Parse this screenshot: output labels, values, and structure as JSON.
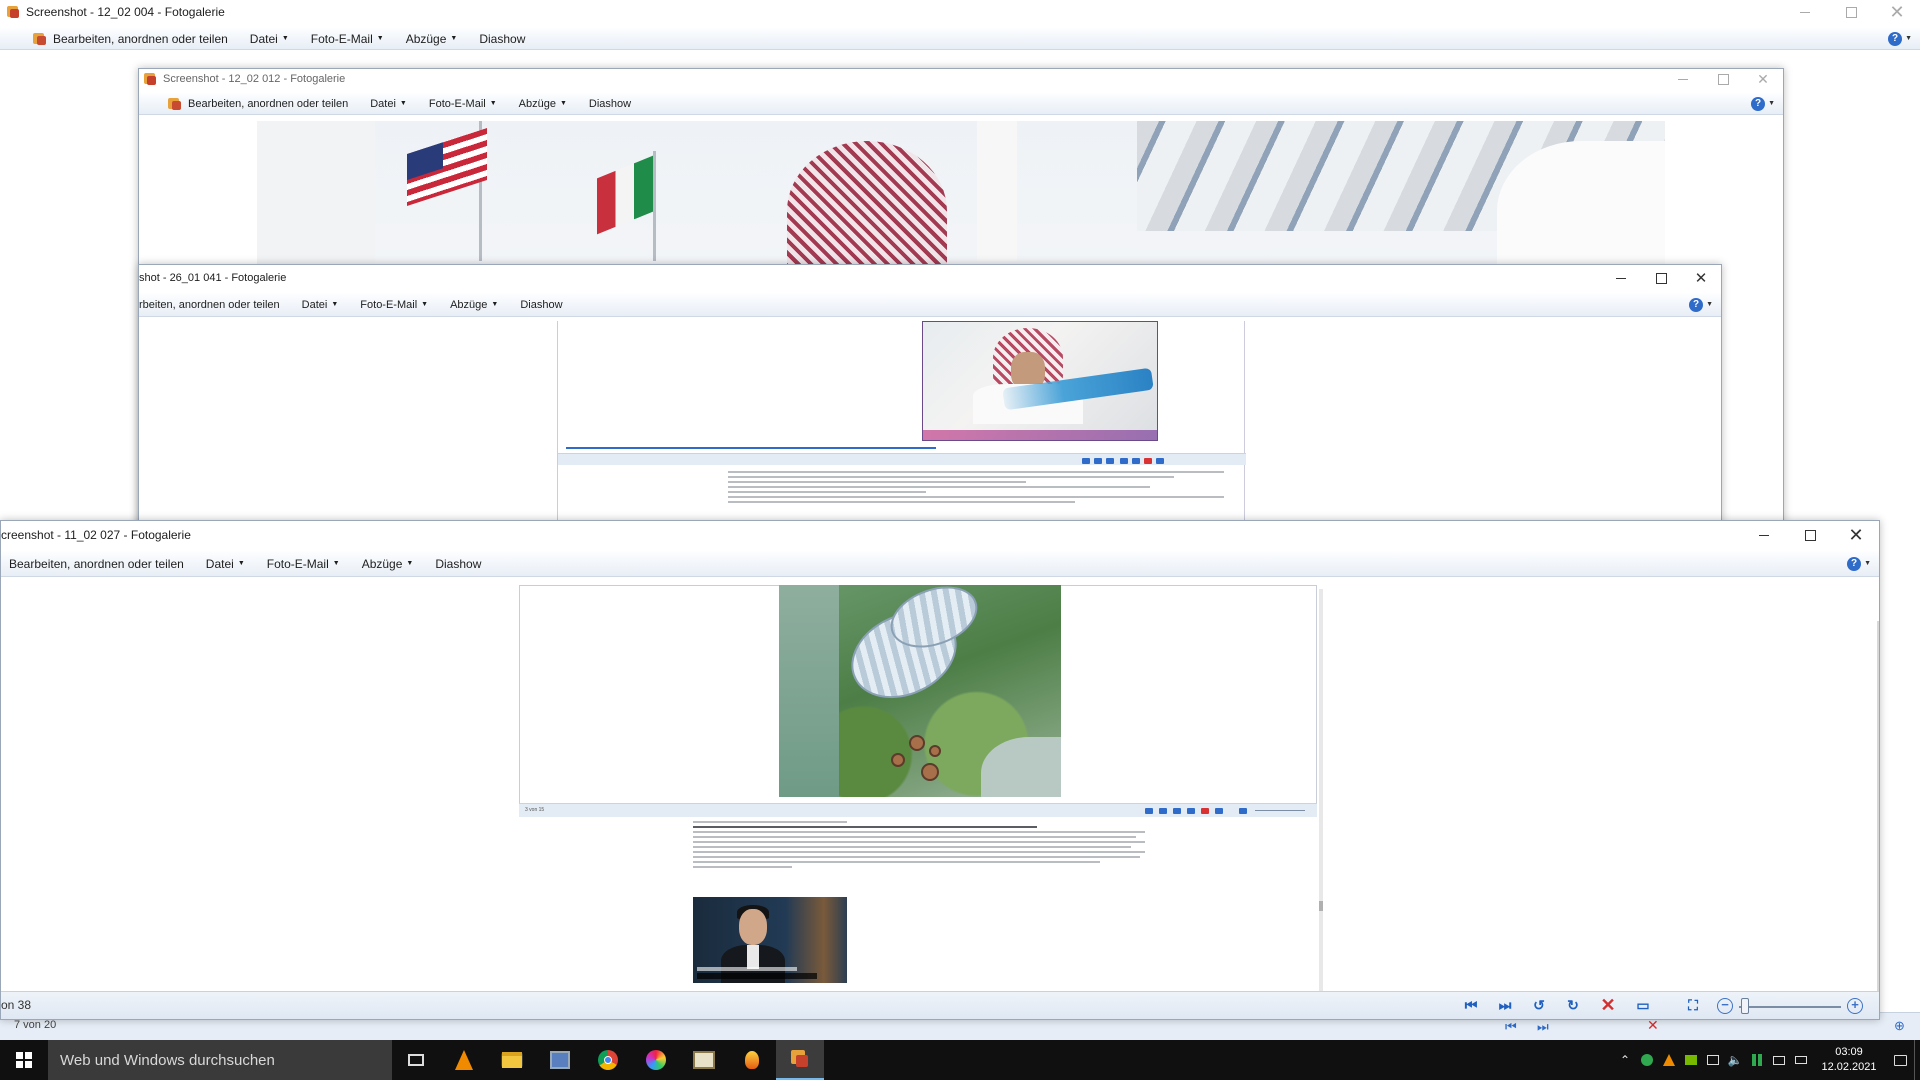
{
  "back_window": {
    "title": "Screenshot - 12_02 004 - Fotogalerie",
    "menu": {
      "edit": "Bearbeiten, anordnen oder teilen",
      "file": "Datei",
      "email": "Foto-E-Mail",
      "prints": "Abzüge",
      "slideshow": "Diashow"
    },
    "footer_counter": "7 von 20"
  },
  "window2": {
    "title": "Screenshot - 12_02 012 - Fotogalerie",
    "menu": {
      "edit": "Bearbeiten, anordnen oder teilen",
      "file": "Datei",
      "email": "Foto-E-Mail",
      "prints": "Abzüge",
      "slideshow": "Diashow"
    }
  },
  "window3": {
    "title": "shot - 26_01 041 - Fotogalerie",
    "menu": {
      "edit": "rbeiten, anordnen oder teilen",
      "file": "Datei",
      "email": "Foto-E-Mail",
      "prints": "Abzüge",
      "slideshow": "Diashow"
    }
  },
  "front_window": {
    "title": "creenshot - 11_02 027 - Fotogalerie",
    "menu": {
      "edit": "Bearbeiten, anordnen oder teilen",
      "file": "Datei",
      "email": "Foto-E-Mail",
      "prints": "Abzüge",
      "slideshow": "Diashow"
    },
    "counter": "on 38",
    "zoom_level_percent": 6
  },
  "icons": {
    "prev": "first-image-icon",
    "next": "last-image-icon",
    "rotate_left": "rotate-left-icon",
    "rotate_right": "rotate-right-icon",
    "delete": "delete-icon",
    "slideshow": "slideshow-icon",
    "fit": "actual-size-icon",
    "zoom_out": "zoom-out-icon",
    "zoom_in": "zoom-in-icon",
    "help": "help-icon"
  },
  "taskbar": {
    "search_placeholder": "Web und Windows durchsuchen",
    "time": "03:09",
    "date": "12.02.2021"
  },
  "colors": {
    "accent": "#2f6bc9",
    "taskbar": "#101010",
    "delete_red": "#d42f2f"
  }
}
